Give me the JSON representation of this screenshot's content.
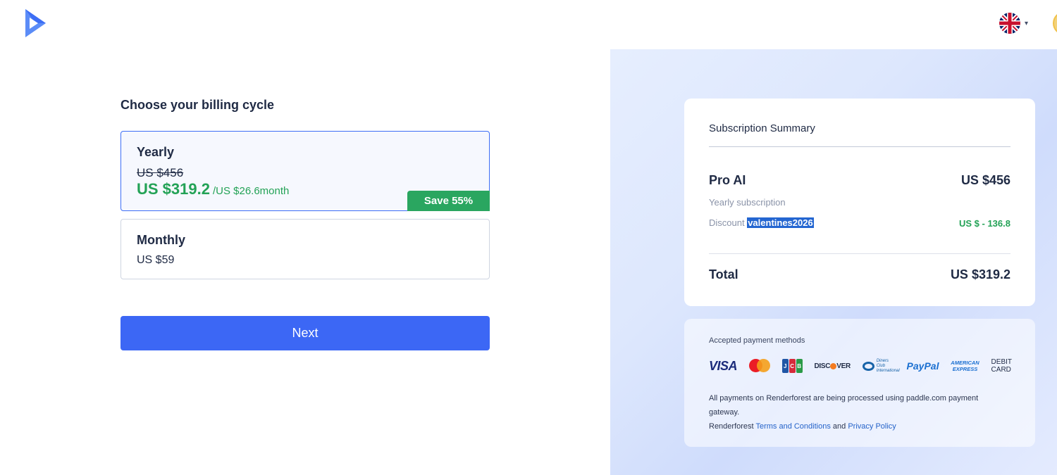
{
  "header": {
    "logo_icon": "renderforest-play-logo",
    "language_icon": "uk-flag-icon",
    "language_caret": "▾"
  },
  "billing": {
    "title": "Choose your billing cycle",
    "plans": [
      {
        "name": "Yearly",
        "old_price": "US $456",
        "new_price": "US $319.2",
        "per_month": "/US $26.6month",
        "badge": "Save 55%",
        "selected": true
      },
      {
        "name": "Monthly",
        "price": "US $59",
        "selected": false
      }
    ],
    "next_label": "Next"
  },
  "summary": {
    "title": "Subscription Summary",
    "product_name": "Pro AI",
    "product_price": "US $456",
    "subscription_type": "Yearly subscription",
    "discount_label": "Discount",
    "discount_code": "valentines2026",
    "discount_value": "US $ - 136.8",
    "total_label": "Total",
    "total_value": "US $319.2"
  },
  "payment": {
    "title": "Accepted payment methods",
    "methods": [
      "VISA",
      "Mastercard",
      "JCB",
      "DISCOVER",
      "Diners Club International",
      "PayPal",
      "AMERICAN EXPRESS",
      "DEBIT CARD"
    ],
    "note_line1": "All payments on Renderforest are being processed using paddle.com payment gateway.",
    "note_prefix": "Renderforest",
    "terms_label": "Terms and Conditions",
    "and_text": "and",
    "privacy_label": "Privacy Policy"
  },
  "colors": {
    "accent": "#3c67f5",
    "green": "#23a256",
    "text": "#1f2a44"
  }
}
